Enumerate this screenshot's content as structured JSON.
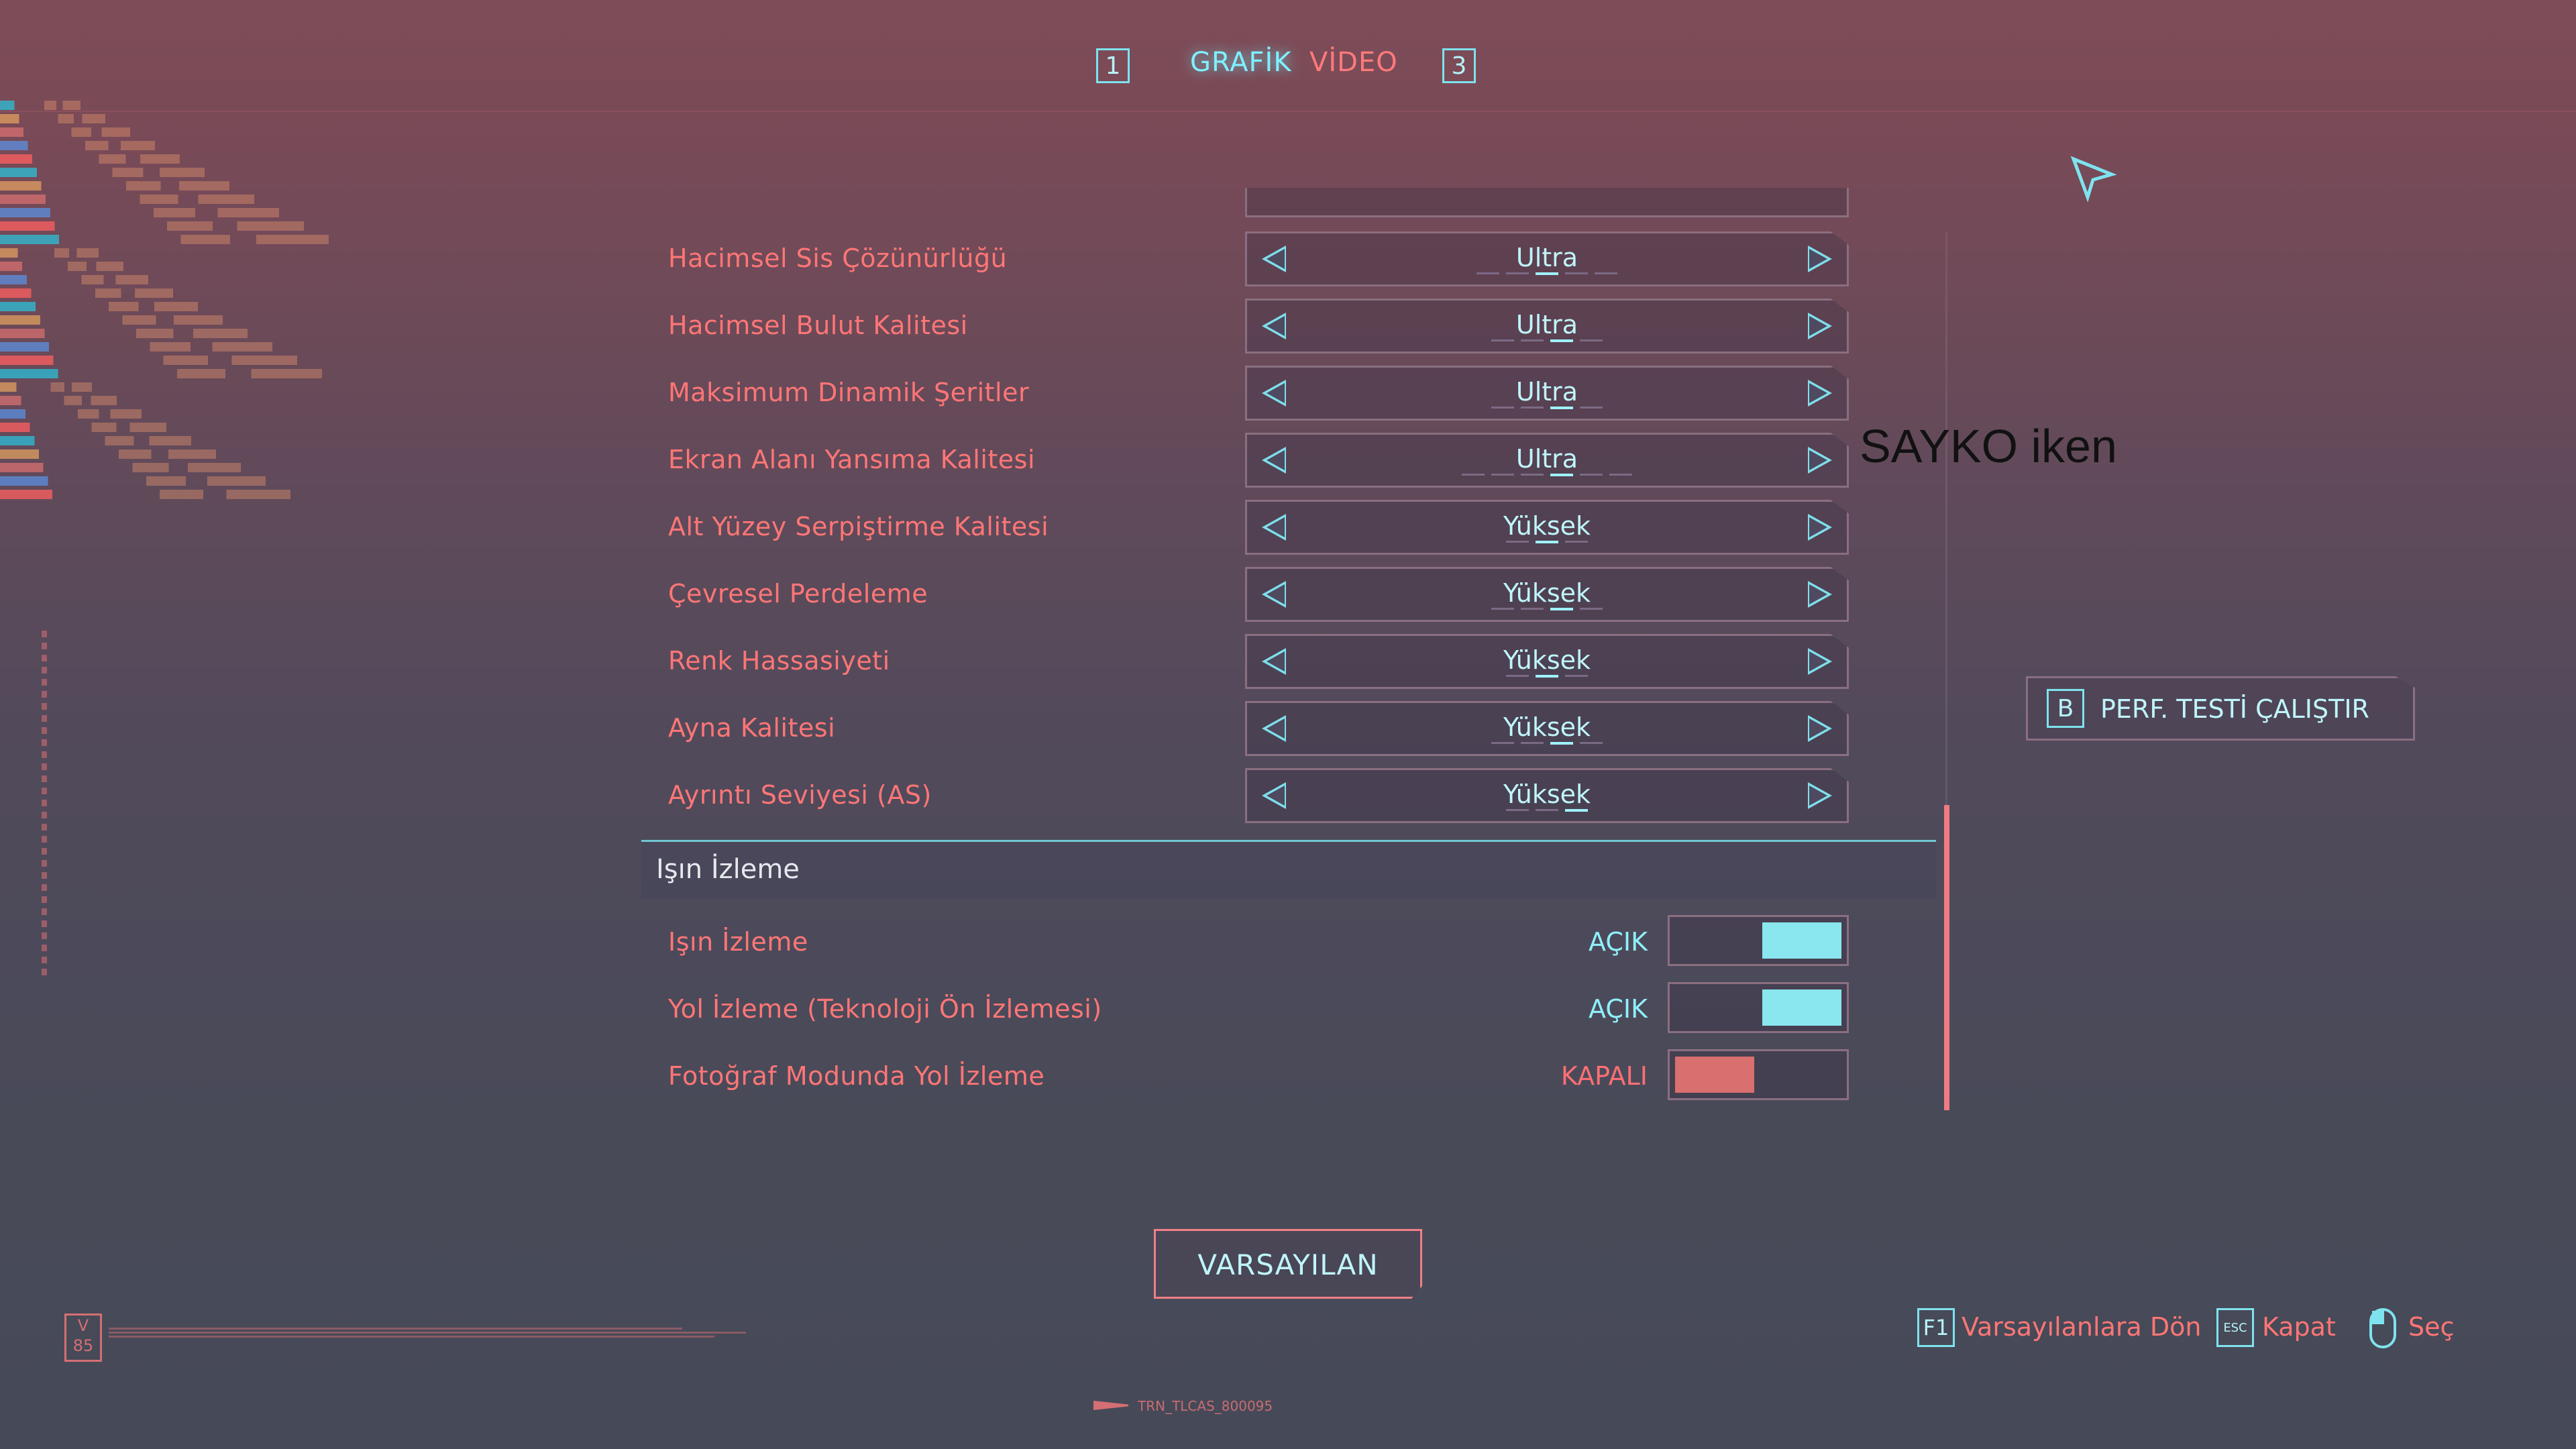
{
  "tabs": {
    "left_key": "1",
    "active": "GRAFİK",
    "inactive": "VİDEO",
    "right_key": "3"
  },
  "watermark": "SAYKO iken",
  "settings": [
    {
      "label": "Hacimsel Sis Çözünürlüğü",
      "value": "Ultra",
      "dots": 5,
      "active_dot": 3
    },
    {
      "label": "Hacimsel Bulut Kalitesi",
      "value": "Ultra",
      "dots": 4,
      "active_dot": 3
    },
    {
      "label": "Maksimum Dinamik Şeritler",
      "value": "Ultra",
      "dots": 4,
      "active_dot": 3
    },
    {
      "label": "Ekran Alanı Yansıma Kalitesi",
      "value": "Ultra",
      "dots": 6,
      "active_dot": 4
    },
    {
      "label": "Alt Yüzey Serpiştirme Kalitesi",
      "value": "Yüksek",
      "dots": 3,
      "active_dot": 2
    },
    {
      "label": "Çevresel Perdeleme",
      "value": "Yüksek",
      "dots": 4,
      "active_dot": 3
    },
    {
      "label": "Renk Hassasiyeti",
      "value": "Yüksek",
      "dots": 3,
      "active_dot": 2
    },
    {
      "label": "Ayna Kalitesi",
      "value": "Yüksek",
      "dots": 4,
      "active_dot": 3
    },
    {
      "label": "Ayrıntı Seviyesi (AS)",
      "value": "Yüksek",
      "dots": 3,
      "active_dot": 3
    }
  ],
  "section": {
    "title": "Işın İzleme"
  },
  "toggles": [
    {
      "label": "Işın İzleme",
      "state": "AÇIK",
      "on": true
    },
    {
      "label": "Yol İzleme (Teknoloji Ön İzlemesi)",
      "state": "AÇIK",
      "on": true
    },
    {
      "label": "Fotoğraf Modunda Yol İzleme",
      "state": "KAPALI",
      "on": false
    }
  ],
  "perf_button": {
    "key": "B",
    "label": "PERF. TESTİ ÇALIŞTIR"
  },
  "default_button": {
    "label": "VARSAYILAN"
  },
  "hints": [
    {
      "key": "F1",
      "label": "Varsayılanlara Dön"
    },
    {
      "key": "ESC",
      "label": "Kapat"
    },
    {
      "key": "mouse",
      "label": "Seç"
    }
  ],
  "footer_code": "TRN_TLCAS_800095",
  "version_badge": "V\n85",
  "colors": {
    "accent_cyan": "#7ff0ff",
    "accent_red": "#ff7676"
  },
  "icons": [
    "cursor-arrow-icon",
    "mouse-icon",
    "chevron-left-icon",
    "chevron-right-icon"
  ]
}
